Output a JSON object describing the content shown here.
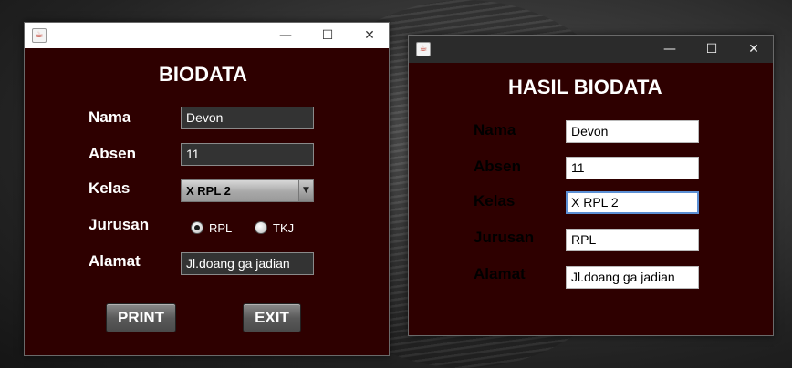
{
  "form_window": {
    "icon": "java-cup-icon",
    "controls": {
      "minimize": "—",
      "maximize": "☐",
      "close": "✕"
    },
    "title": "BIODATA",
    "labels": {
      "nama": "Nama",
      "absen": "Absen",
      "kelas": "Kelas",
      "jurusan": "Jurusan",
      "alamat": "Alamat"
    },
    "values": {
      "nama": "Devon",
      "absen": "11",
      "kelas": "X RPL 2",
      "alamat": "Jl.doang ga jadian"
    },
    "jurusan_options": [
      {
        "label": "RPL",
        "selected": true
      },
      {
        "label": "TKJ",
        "selected": false
      }
    ],
    "buttons": {
      "print": "PRINT",
      "exit": "EXIT"
    }
  },
  "result_window": {
    "icon": "java-cup-icon",
    "controls": {
      "minimize": "—",
      "maximize": "☐",
      "close": "✕"
    },
    "title": "HASIL BIODATA",
    "labels": {
      "nama": "Nama",
      "absen": "Absen",
      "kelas": "Kelas",
      "jurusan": "Jurusan",
      "alamat": "Alamat"
    },
    "values": {
      "nama": "Devon",
      "absen": "11",
      "kelas": "X RPL 2",
      "jurusan": "RPL",
      "alamat": "Jl.doang ga jadian"
    }
  },
  "colors": {
    "content_background": "#2e0000",
    "dark_titlebar": "#2b2b2b",
    "focus_border": "#5b8fd4"
  }
}
